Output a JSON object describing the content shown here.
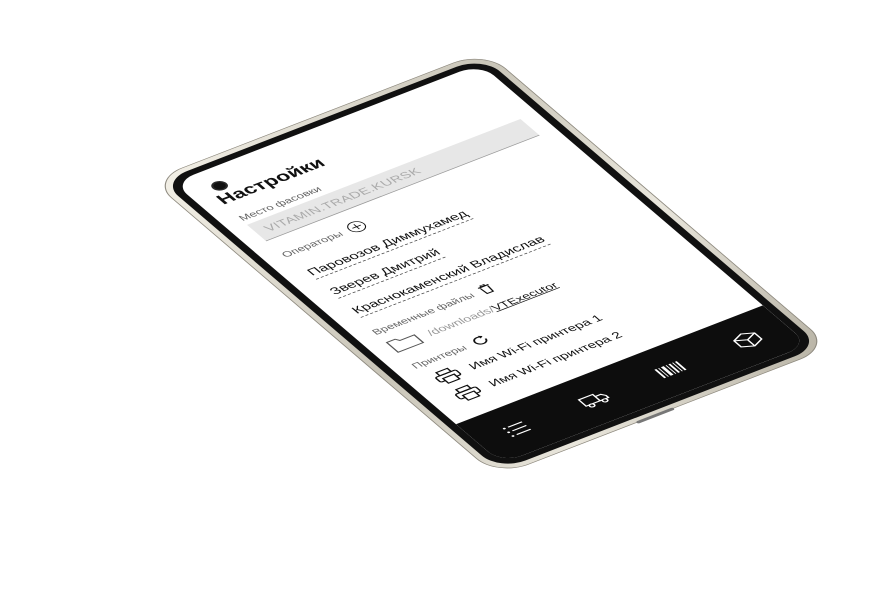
{
  "screen": {
    "title": "Настройки",
    "packing_place": {
      "label": "Место фасовки",
      "value": "VITAMIN.TRADE.KURSK"
    },
    "operators": {
      "label": "Операторы",
      "items": [
        "Паровозов Диммухамед",
        "Зверев Дмитрий",
        "Краснокаменский Владислав"
      ]
    },
    "temp_files": {
      "label": "Временные файлы",
      "path_prefix": "/downloads/",
      "path_link": "VTExecutor"
    },
    "printers": {
      "label": "Принтеры",
      "items": [
        "Имя Wi-Fi принтера 1",
        "Имя Wi-Fi принтера 2"
      ]
    }
  },
  "navbar": {
    "icons": [
      "menu-icon",
      "truck-icon",
      "barcode-icon",
      "box-icon"
    ]
  }
}
